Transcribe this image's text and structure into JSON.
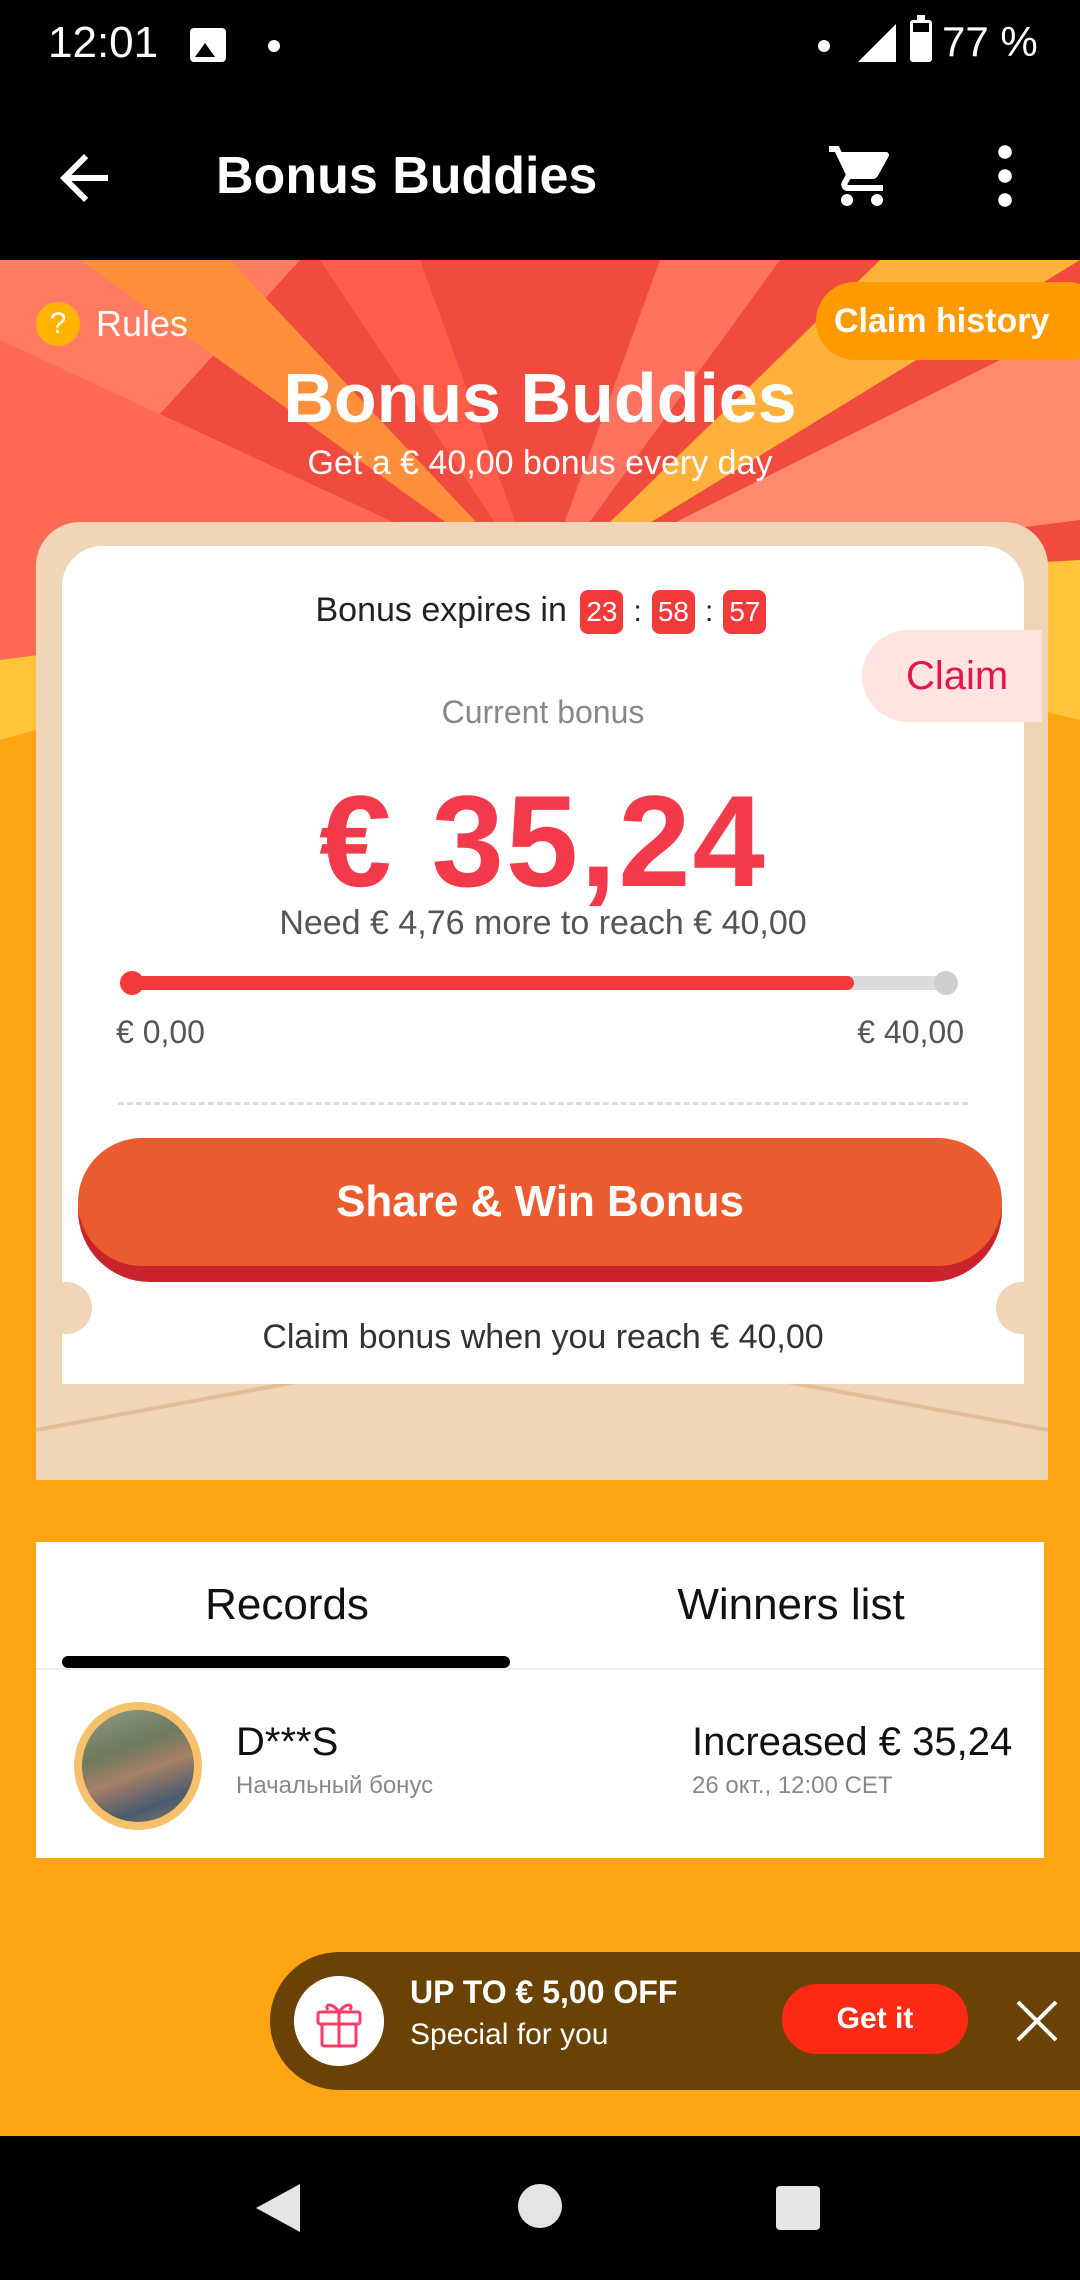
{
  "status_bar": {
    "time": "12:01",
    "battery": "77 %"
  },
  "app_bar": {
    "title": "Bonus Buddies"
  },
  "header": {
    "rules_icon": "?",
    "rules_label": "Rules",
    "claim_history_label": "Claim history",
    "title": "Bonus Buddies",
    "subtitle": "Get a € 40,00 bonus every day"
  },
  "bonus": {
    "expires_label": "Bonus expires in",
    "timer": {
      "hours": "23",
      "minutes": "58",
      "seconds": "57",
      "separator": ":"
    },
    "claim_label": "Claim",
    "current_label": "Current bonus",
    "amount": "€ 35,24",
    "need_text": "Need € 4,76 more to reach € 40,00",
    "progress_fraction": 0.881,
    "progress_min": "€ 0,00",
    "progress_max": "€ 40,00",
    "share_button": "Share & Win Bonus",
    "claim_note": "Claim bonus when you reach € 40,00"
  },
  "records": {
    "tabs": [
      {
        "label": "Records",
        "active": true
      },
      {
        "label": "Winners list",
        "active": false
      }
    ],
    "items": [
      {
        "name": "D***S",
        "type": "Начальный бонус",
        "amount": "Increased € 35,24",
        "time": "26 окт., 12:00 CET"
      }
    ]
  },
  "promo": {
    "title": "UP TO € 5,00 OFF",
    "subtitle": "Special for you",
    "button": "Get it"
  },
  "colors": {
    "accent": "#f23a3a",
    "background": "#ffa412",
    "button": "#ea5b2f"
  }
}
